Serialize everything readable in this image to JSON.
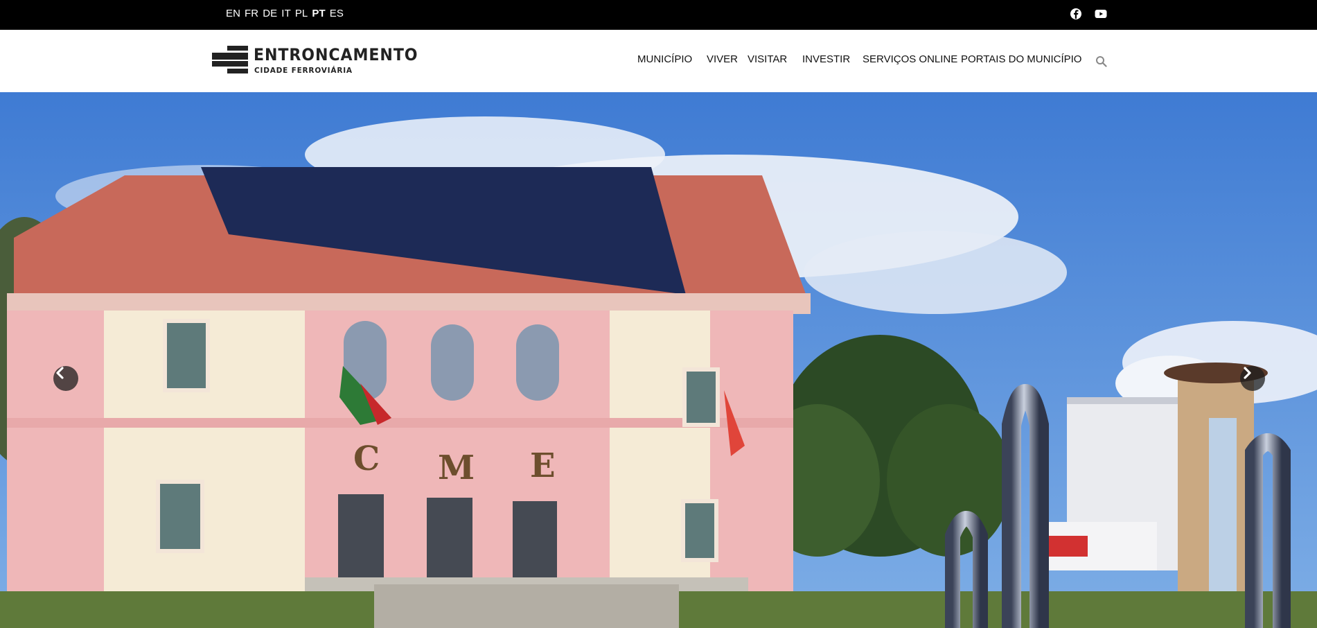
{
  "topbar": {
    "languages": [
      {
        "code": "EN",
        "active": false
      },
      {
        "code": "FR",
        "active": false
      },
      {
        "code": "DE",
        "active": false
      },
      {
        "code": "IT",
        "active": false
      },
      {
        "code": "PL",
        "active": false
      },
      {
        "code": "PT",
        "active": true
      },
      {
        "code": "ES",
        "active": false
      }
    ],
    "social": [
      {
        "icon": "facebook-icon"
      },
      {
        "icon": "youtube-icon"
      }
    ]
  },
  "header": {
    "logo": {
      "title": "ENTRONCAMENTO",
      "subtitle": "CIDADE FERROVIÁRIA"
    },
    "nav": [
      {
        "label": "MUNICÍPIO"
      },
      {
        "label": "VIVER"
      },
      {
        "label": "VISITAR"
      },
      {
        "label": "INVESTIR"
      },
      {
        "label": "SERVIÇOS ONLINE"
      },
      {
        "label": "PORTAIS DO MUNICÍPIO"
      }
    ],
    "search_icon": "search-icon"
  },
  "hero": {
    "building_letters": [
      "C",
      "M",
      "E"
    ],
    "prev_icon": "chevron-left-icon",
    "next_icon": "chevron-right-icon"
  },
  "colors": {
    "topbar_bg": "#000000",
    "header_bg": "#ffffff",
    "sky": "#4d86d6",
    "building_pink": "#f0b7b8"
  }
}
